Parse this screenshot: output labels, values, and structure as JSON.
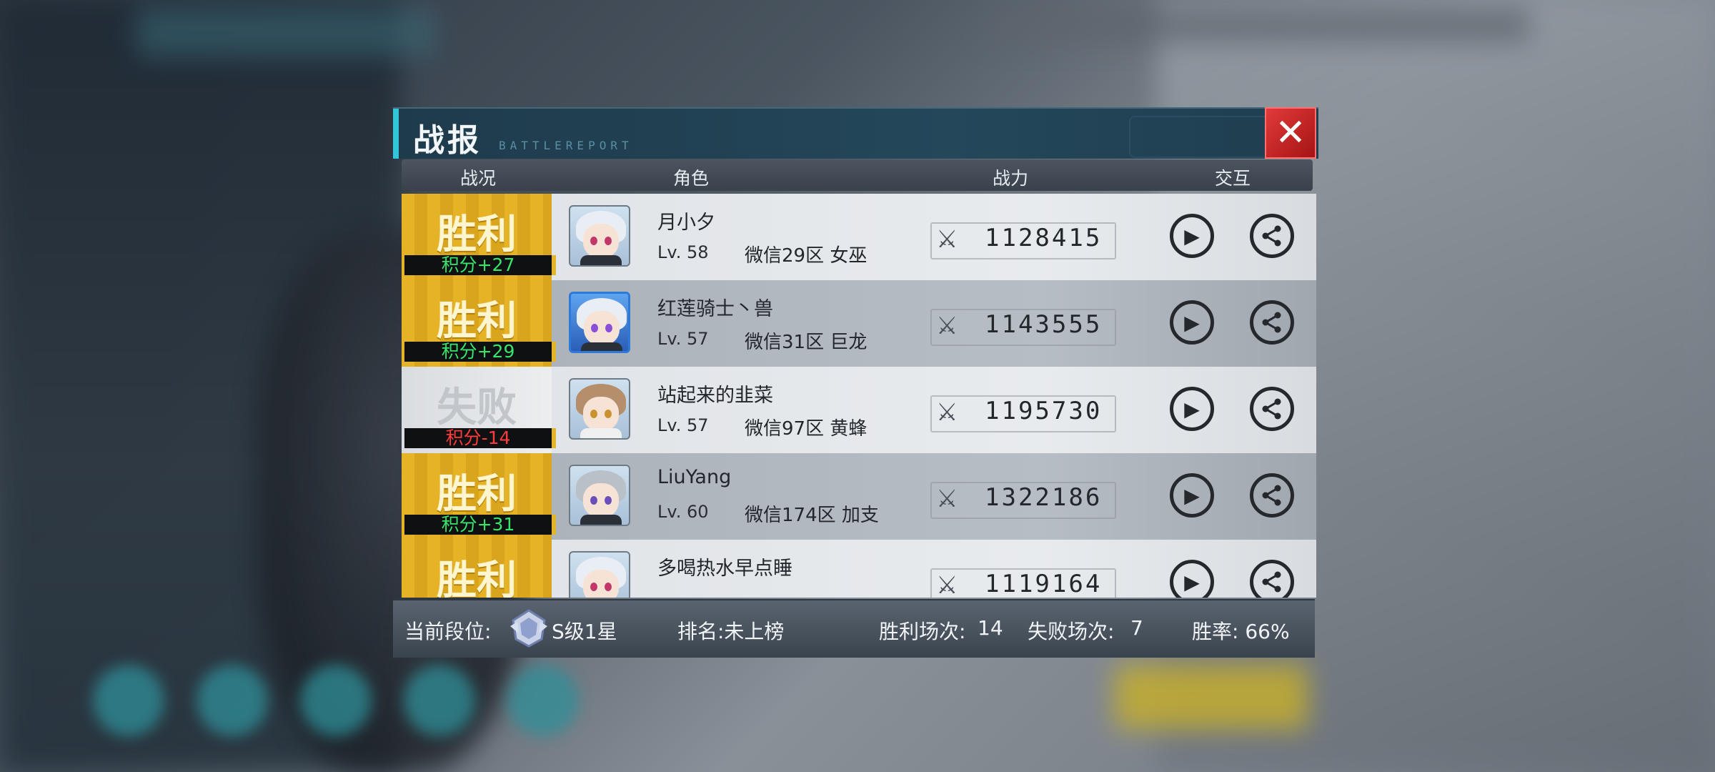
{
  "dialog": {
    "title": "战报",
    "subtitle": "BATTLEREPORT",
    "close_label": "✕"
  },
  "columns": {
    "status": "战况",
    "role": "角色",
    "power": "战力",
    "interact": "交互"
  },
  "rows": [
    {
      "result": "胜利",
      "score": "积分+27",
      "name": "月小夕",
      "level": "Lv. 58",
      "server": "微信29区 女巫",
      "power": "1128415"
    },
    {
      "result": "胜利",
      "score": "积分+29",
      "name": "红莲骑士丶兽",
      "level": "Lv. 57",
      "server": "微信31区 巨龙",
      "power": "1143555"
    },
    {
      "result": "失败",
      "score": "积分-14",
      "name": "站起来的韭菜",
      "level": "Lv. 57",
      "server": "微信97区 黄蜂",
      "power": "1195730"
    },
    {
      "result": "胜利",
      "score": "积分+31",
      "name": "LiuYang",
      "level": "Lv. 60",
      "server": "微信174区 加支",
      "power": "1322186"
    },
    {
      "result": "胜利",
      "score": "",
      "name": "多喝热水早点睡",
      "level": "",
      "server": "",
      "power": "1119164"
    }
  ],
  "footer": {
    "rank_label": "当前段位:",
    "rank_value": "S级1星",
    "ranking": "排名:未上榜",
    "wins_label": "胜利场次:",
    "wins_value": "14",
    "losses_label": "失败场次:",
    "losses_value": "7",
    "win_rate": "胜率: 66%"
  },
  "colors": {
    "accent": "#33c6d8",
    "win_bg": "#e2b52a",
    "score_positive": "#39e46a",
    "score_negative": "#ff3b3b",
    "close_red": "#d62a2a"
  },
  "icons": {
    "close": "close-icon",
    "play": "play-icon",
    "share": "share-icon",
    "power": "power-icon",
    "rank": "rank-badge-icon"
  }
}
